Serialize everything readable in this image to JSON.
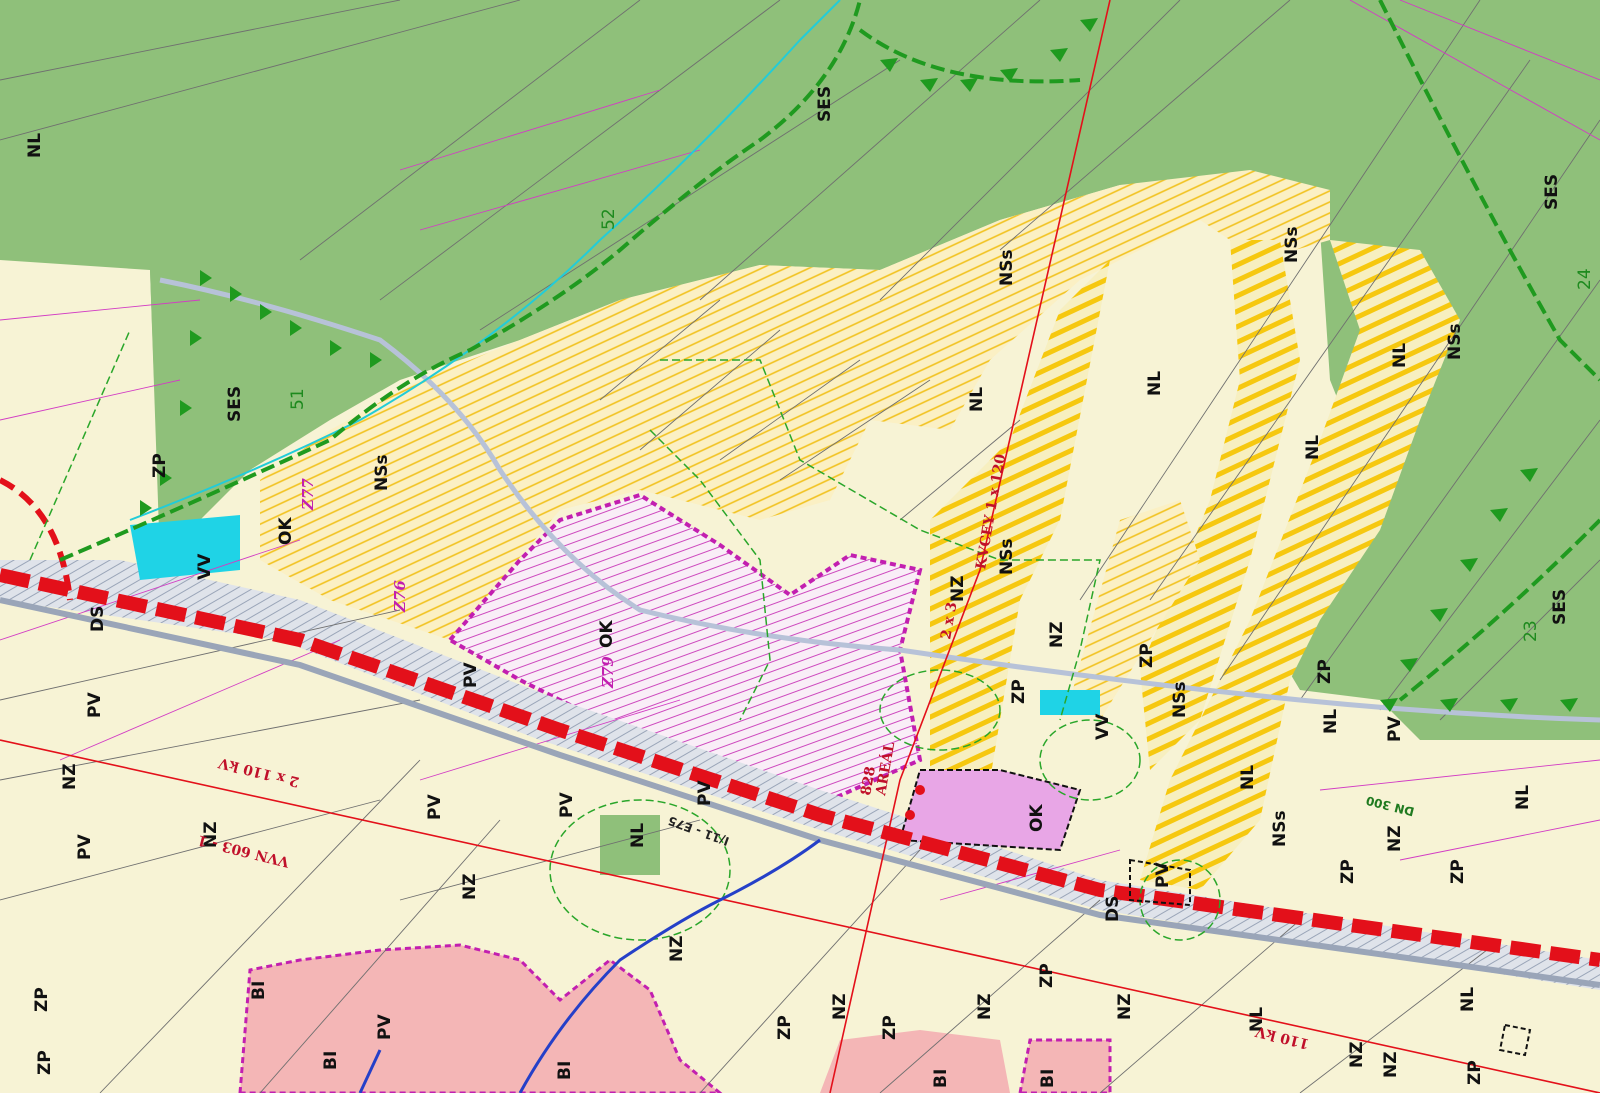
{
  "map": {
    "colors": {
      "forest": "#8fc07a",
      "arable": "#f7f3d5",
      "hatch_yellow": "#f2c21f",
      "built": "#f4b6b6",
      "magenta": "#c21fb0",
      "red": "#e3101a",
      "water": "#1fd3e6",
      "green_line": "#1f9a1f"
    },
    "zone_labels": {
      "nl_1": "NL",
      "ses_1": "SES",
      "ses_2": "SES",
      "ses_3": "SES",
      "ses_4": "SES",
      "nss_1": "NSs",
      "nss_2": "NSs",
      "nss_3": "NSs",
      "nss_4": "NSs",
      "nss_5": "NSs",
      "nss_6": "NSs",
      "nss_7": "NSs",
      "nl_2": "NL",
      "nl_3": "NL",
      "nl_4": "NL",
      "nl_5": "NL",
      "nl_6": "NL",
      "nl_7": "NL",
      "nl_8": "NL",
      "nl_9": "NL",
      "nl_10": "NL",
      "nl_11": "NL",
      "zp_1": "ZP",
      "zp_2": "ZP",
      "zp_3": "ZP",
      "zp_4": "ZP",
      "zp_5": "ZP",
      "zp_6": "ZP",
      "zp_7": "ZP",
      "zp_8": "ZP",
      "zp_9": "ZP",
      "zp_10": "ZP",
      "zp_11": "ZP",
      "zp_12": "ZP",
      "vv_1": "VV",
      "vv_2": "VV",
      "ok_1": "OK",
      "ok_2": "OK",
      "ok_3": "OK",
      "ds_1": "DS",
      "ds_2": "DS",
      "pv_1": "PV",
      "pv_2": "PV",
      "pv_3": "PV",
      "pv_4": "PV",
      "pv_5": "PV",
      "pv_6": "PV",
      "pv_7": "PV",
      "pv_8": "PV",
      "pv_9": "PV",
      "nz_1": "NZ",
      "nz_2": "NZ",
      "nz_3": "NZ",
      "nz_4": "NZ",
      "nz_5": "NZ",
      "nz_6": "NZ",
      "nz_7": "NZ",
      "nz_8": "NZ",
      "nz_9": "NZ",
      "nz_10": "NZ",
      "nz_11": "NZ",
      "nz_12": "NZ",
      "nz_13": "NZ",
      "bi_1": "BI",
      "bi_2": "BI",
      "bi_3": "BI",
      "bi_4": "BI",
      "bi_5": "BI"
    },
    "annotations": {
      "corridor_52": "52",
      "corridor_51": "51",
      "corridor_24": "24",
      "corridor_23": "23",
      "z76": "Z76",
      "z77": "Z77",
      "z79": "Z79",
      "kvcey": "KVCEY 1 x 120",
      "two_x_three": "2 x 3",
      "two_x_110": "2 x 110 kV",
      "vvn_603": "VVN 603 - 1",
      "line_110kv": "110 kV",
      "dn300": "DN 300",
      "highway": "I/11 - E75",
      "area": "AREÁL",
      "num_828": "828"
    }
  }
}
